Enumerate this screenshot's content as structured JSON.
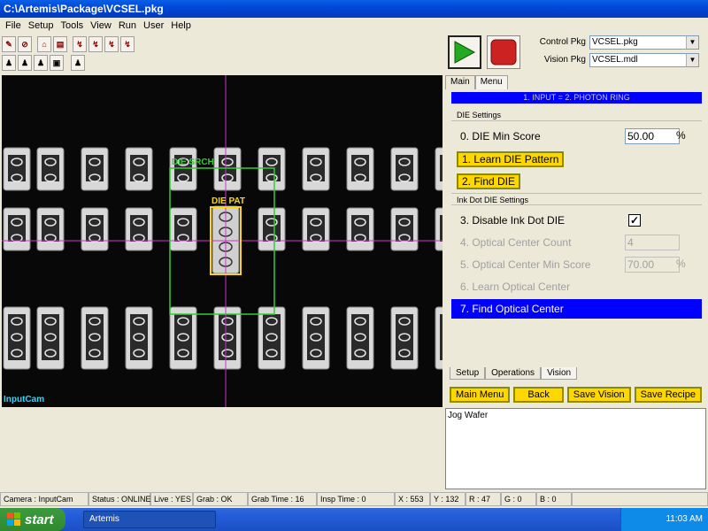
{
  "window": {
    "title": "C:\\Artemis\\Package\\VCSEL.pkg"
  },
  "menu": [
    "File",
    "Setup",
    "Tools",
    "View",
    "Run",
    "User",
    "Help"
  ],
  "toolbar": {
    "row1_icons": [
      "tool-icon-1",
      "tool-icon-2",
      "tool-icon-3",
      "tool-icon-4",
      "tool-icon-5",
      "tool-icon-6",
      "tool-icon-7",
      "tool-icon-8"
    ],
    "row2_icons": [
      "tool-icon-1",
      "tool-icon-2",
      "tool-icon-3",
      "tool-icon-4",
      "tool-icon-5"
    ]
  },
  "run": {
    "control_label": "Control Pkg",
    "control_value": "VCSEL.pkg",
    "vision_label": "Vision Pkg",
    "vision_value": "VCSEL.mdl"
  },
  "camera": {
    "name": "InputCam",
    "search_label": "DIE SRCH",
    "pattern_label": "DIE PAT"
  },
  "panel": {
    "tabs": [
      "Main",
      "Menu"
    ],
    "header": "1. INPUT = 2. PHOTON RING",
    "die_section": "DIE Settings",
    "min_score_label": "0.  DIE Min Score",
    "min_score_value": "50.00",
    "min_score_unit": "%",
    "learn_pattern": "1.  Learn DIE Pattern",
    "find_die": "2.  Find DIE",
    "ink_section": "Ink Dot DIE Settings",
    "disable_ink": "3.  Disable Ink Dot DIE",
    "disable_ink_checked": true,
    "optical_count_label": "4.  Optical Center Count",
    "optical_count_value": "4",
    "optical_min_label": "5.  Optical Center Min Score",
    "optical_min_value": "70.00",
    "optical_min_unit": "%",
    "learn_optical": "6.  Learn Optical Center",
    "find_optical": "7.  Find Optical Center",
    "bottom_tabs": [
      "Setup",
      "Operations",
      "Vision"
    ],
    "actions": [
      "Main Menu",
      "Back",
      "Save Vision",
      "Save Recipe"
    ]
  },
  "log": {
    "text": "Jog Wafer"
  },
  "status": {
    "camera": "Camera : InputCam",
    "status": "Status : ONLINE",
    "live": "Live : YES",
    "grab": "Grab : OK",
    "grab_time": "Grab Time : 16",
    "insp_time": "Insp Time : 0",
    "x": "X : 553",
    "y": "Y : 132",
    "r": "R : 47",
    "g": "G : 0",
    "b": "B : 0"
  },
  "taskbar": {
    "start": "start",
    "app": "Artemis",
    "time": "11:03 AM"
  },
  "colors": {
    "accent_blue": "#0000ff",
    "button_yellow": "#ffd700",
    "crosshair": "#cc33cc",
    "roi_green": "#33cc33"
  }
}
